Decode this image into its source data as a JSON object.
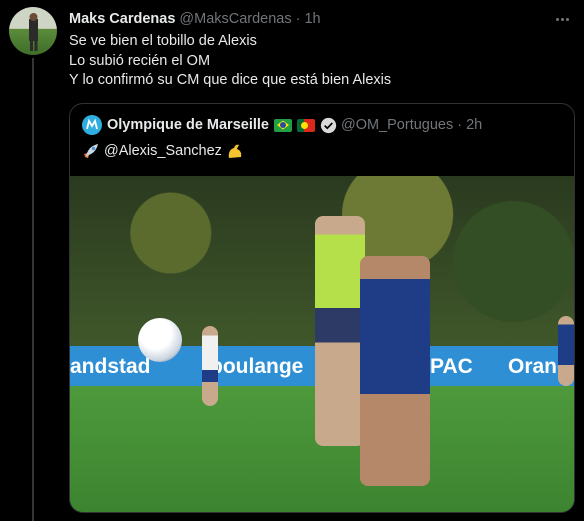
{
  "tweet": {
    "author_name": "Maks Cardenas",
    "author_handle": "@MaksCardenas",
    "separator": "·",
    "time": "1h",
    "lines": [
      "Se ve bien el tobillo de Alexis",
      "Lo subió recién el OM",
      "Y lo confirmó su CM que dice que está bien Alexis"
    ]
  },
  "quote": {
    "author_name": "Olympique de Marseille",
    "author_handle": "@OM_Portugues",
    "separator": "·",
    "time": "2h",
    "text": "@Alexis_Sanchez",
    "flags": [
      "brazil-flag",
      "portugal-flag"
    ],
    "photo": {
      "banner_texts": [
        "andstad",
        "boulange",
        "PAC",
        "Orang"
      ]
    }
  },
  "colors": {
    "background": "#000000",
    "primary_text": "#e7e9ea",
    "secondary_text": "#71767b",
    "border": "#2f3336",
    "om_blue": "#2faee0"
  }
}
